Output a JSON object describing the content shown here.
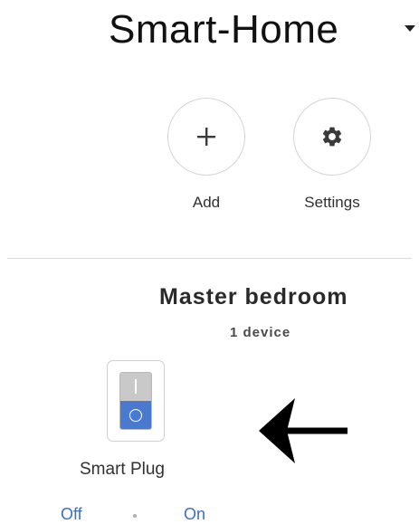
{
  "header": {
    "home_title": "Smart-Home",
    "dropdown_icon": "caret-down-icon"
  },
  "actions": [
    {
      "label": "Add",
      "icon": "plus-icon"
    },
    {
      "label": "Settings",
      "icon": "gear-icon"
    }
  ],
  "room": {
    "name": "Master bedroom",
    "device_count": "1 device"
  },
  "device": {
    "name": "Smart Plug",
    "icon": "power-switch-icon",
    "off_label": "Off",
    "on_label": "On"
  },
  "colors": {
    "accent": "#3d6fc4",
    "switch_on": "#4a7ad0",
    "switch_off": "#c9c9c9"
  }
}
